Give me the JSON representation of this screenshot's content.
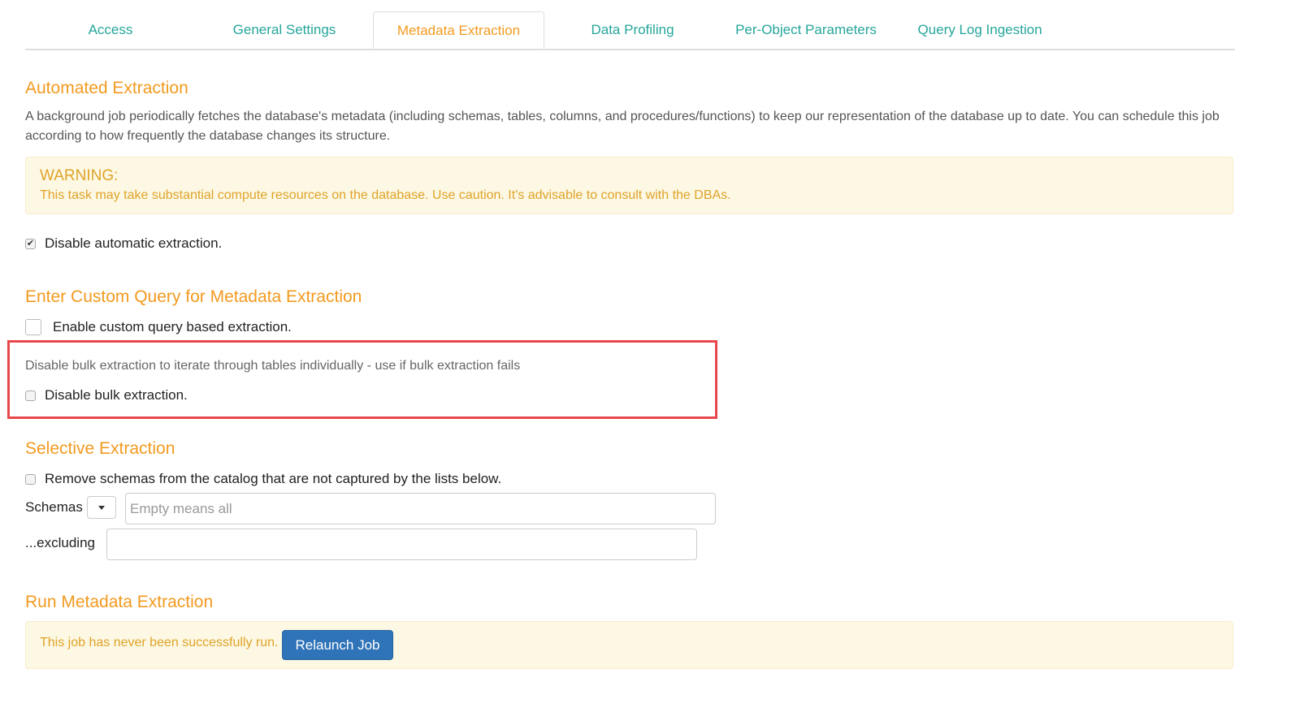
{
  "tabs": [
    {
      "label": "Access"
    },
    {
      "label": "General Settings"
    },
    {
      "label": "Metadata Extraction",
      "active": true
    },
    {
      "label": "Data Profiling"
    },
    {
      "label": "Per-Object Parameters"
    },
    {
      "label": "Query Log Ingestion"
    }
  ],
  "automated": {
    "title": "Automated Extraction",
    "description": "A background job periodically fetches the database's metadata (including schemas, tables, columns, and procedures/functions) to keep our representation of the database up to date. You can schedule this job according to how frequently the database changes its structure.",
    "warning_title": "WARNING:",
    "warning_text": "This task may take substantial compute resources on the database. Use caution. It's advisable to consult with the DBAs.",
    "disable_auto_label": "Disable automatic extraction.",
    "disable_auto_checked": true
  },
  "custom_query": {
    "title": "Enter Custom Query for Metadata Extraction",
    "enable_label": "Enable custom query based extraction.",
    "enable_checked": false,
    "bulk_hint": "Disable bulk extraction to iterate through tables individually - use if bulk extraction fails",
    "bulk_label": "Disable bulk extraction.",
    "bulk_checked": false
  },
  "selective": {
    "title": "Selective Extraction",
    "remove_label": "Remove schemas from the catalog that are not captured by the lists below.",
    "remove_checked": false,
    "schemas_label": "Schemas",
    "schemas_placeholder": "Empty means all",
    "schemas_value": "",
    "excluding_label": "...excluding",
    "excluding_value": ""
  },
  "run": {
    "title": "Run Metadata Extraction",
    "status_text": "This job has never been successfully run.",
    "relaunch_label": "Relaunch Job"
  },
  "colors": {
    "accent_orange": "#f29a1f",
    "tab_teal": "#26a69a",
    "warning_bg": "#fcf8e3",
    "primary_button": "#2f73b8",
    "highlight_red": "#e8474c"
  }
}
